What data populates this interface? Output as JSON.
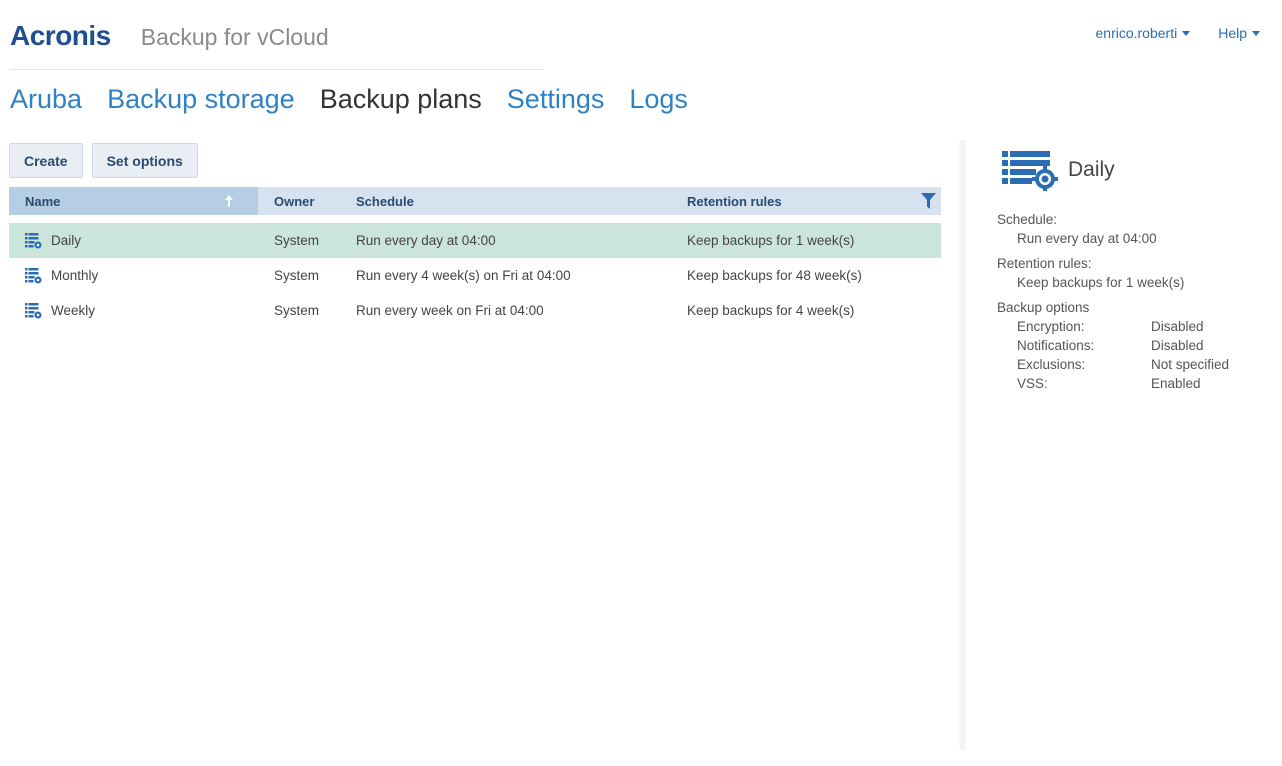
{
  "brand": {
    "logo": "Acronis",
    "product": "Backup for vCloud"
  },
  "user_menu": {
    "user": "enrico.roberti",
    "help": "Help"
  },
  "nav": [
    {
      "label": "Aruba",
      "active": false
    },
    {
      "label": "Backup storage",
      "active": false
    },
    {
      "label": "Backup plans",
      "active": true
    },
    {
      "label": "Settings",
      "active": false
    },
    {
      "label": "Logs",
      "active": false
    }
  ],
  "toolbar": {
    "create_label": "Create",
    "set_options_label": "Set options"
  },
  "table": {
    "columns": {
      "name": "Name",
      "owner": "Owner",
      "schedule": "Schedule",
      "retention": "Retention rules"
    },
    "sort": {
      "column": "name",
      "direction": "asc"
    },
    "rows": [
      {
        "name": "Daily",
        "owner": "System",
        "schedule": "Run every day at 04:00",
        "retention": "Keep backups for 1 week(s)",
        "selected": true
      },
      {
        "name": "Monthly",
        "owner": "System",
        "schedule": "Run every 4 week(s) on Fri at 04:00",
        "retention": "Keep backups for 48 week(s)",
        "selected": false
      },
      {
        "name": "Weekly",
        "owner": "System",
        "schedule": "Run every week on Fri at 04:00",
        "retention": "Keep backups for 4 week(s)",
        "selected": false
      }
    ]
  },
  "details": {
    "title": "Daily",
    "schedule_label": "Schedule:",
    "schedule_value": "Run every day at 04:00",
    "retention_label": "Retention rules:",
    "retention_value": "Keep backups for 1 week(s)",
    "options_label": "Backup options",
    "options": [
      {
        "key": "Encryption:",
        "value": "Disabled"
      },
      {
        "key": "Notifications:",
        "value": "Disabled"
      },
      {
        "key": "Exclusions:",
        "value": "Not specified"
      },
      {
        "key": "VSS:",
        "value": "Enabled"
      }
    ]
  },
  "colors": {
    "brand": "#1d4f91",
    "link": "#2f82c4",
    "selected_row": "#cbe5da",
    "header_bg": "#d6e2f0",
    "sorted_header_bg": "#b6cde6",
    "icon": "#2a6db3"
  },
  "icons": {
    "plan": "backup-plan-icon",
    "sort": "sort-ascending-icon",
    "filter": "filter-icon",
    "caret": "chevron-down-icon"
  }
}
